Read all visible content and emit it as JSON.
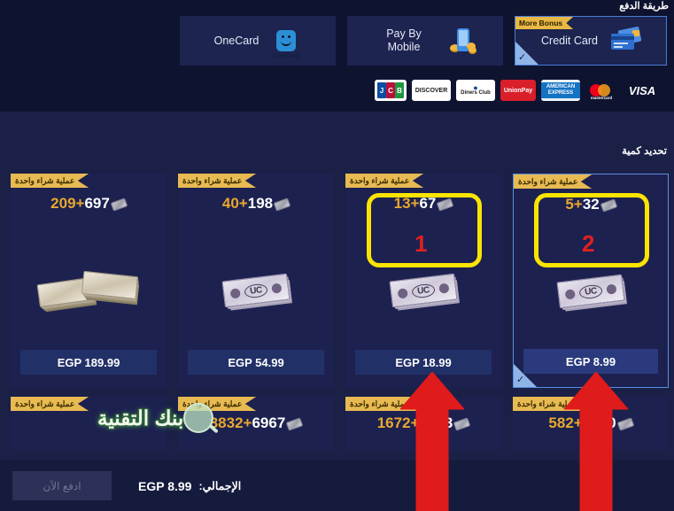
{
  "payment_section": {
    "title": "طريقة الدفع",
    "methods": [
      {
        "label": "OneCard",
        "icon": "onecard-logo-icon",
        "selected": false,
        "badge": ""
      },
      {
        "label": "Pay By Mobile",
        "icon": "mobile-phone-coins-icon",
        "selected": false,
        "badge": ""
      },
      {
        "label": "Credit Card",
        "icon": "credit-card-icon",
        "selected": true,
        "badge": "More Bonus"
      }
    ],
    "brands": [
      "JCB",
      "DISCOVER",
      "Diners Club",
      "UnionPay",
      "AMERICAN EXPRESS",
      "mastercard",
      "VISA"
    ]
  },
  "quantity_section": {
    "title": "تحديد كمية",
    "ribbon_label": "عملية شراء واحدة",
    "currency": "EGP",
    "packs": [
      {
        "base": "209",
        "plus": "+",
        "bonus": "697",
        "price": "EGP 189.99",
        "art": "uc-cash-stack",
        "selected": false
      },
      {
        "base": "40",
        "plus": "+",
        "bonus": "198",
        "price": "EGP 54.99",
        "art": "uc-bill",
        "selected": false
      },
      {
        "base": "13",
        "plus": "+",
        "bonus": "67",
        "price": "EGP 18.99",
        "art": "uc-bill",
        "selected": false
      },
      {
        "base": "5",
        "plus": "+",
        "bonus": "32",
        "price": "EGP 8.99",
        "art": "uc-bill",
        "selected": true
      }
    ],
    "packs_partial": [
      {
        "base": "",
        "plus": "",
        "bonus": ""
      },
      {
        "base": "3832",
        "plus": "+",
        "bonus": "6967"
      },
      {
        "base": "1672",
        "plus": "+",
        "bonus": "3483"
      },
      {
        "base": "582",
        "plus": "+",
        "bonus": "1680"
      }
    ]
  },
  "annotations": {
    "marker_1": "1",
    "marker_2": "2",
    "box_color": "#fbe400",
    "marker_color": "#e02020",
    "arrow_color": "#e01b1b"
  },
  "watermark": {
    "text": "بنك التقنية"
  },
  "footer": {
    "pay_now_label": "ادفع الآن",
    "total_label": "الإجمالي:",
    "total_value": "EGP 8.99"
  }
}
